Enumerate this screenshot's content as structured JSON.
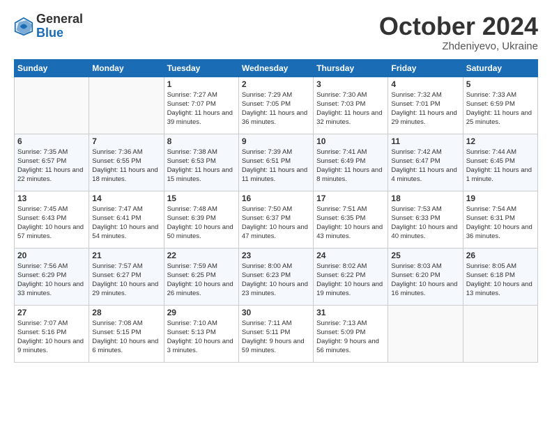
{
  "logo": {
    "general": "General",
    "blue": "Blue"
  },
  "header": {
    "month": "October 2024",
    "location": "Zhdeniyevo, Ukraine"
  },
  "weekdays": [
    "Sunday",
    "Monday",
    "Tuesday",
    "Wednesday",
    "Thursday",
    "Friday",
    "Saturday"
  ],
  "weeks": [
    [
      {
        "day": "",
        "empty": true
      },
      {
        "day": "",
        "empty": true
      },
      {
        "day": "1",
        "info": "Sunrise: 7:27 AM\nSunset: 7:07 PM\nDaylight: 11 hours and 39 minutes."
      },
      {
        "day": "2",
        "info": "Sunrise: 7:29 AM\nSunset: 7:05 PM\nDaylight: 11 hours and 36 minutes."
      },
      {
        "day": "3",
        "info": "Sunrise: 7:30 AM\nSunset: 7:03 PM\nDaylight: 11 hours and 32 minutes."
      },
      {
        "day": "4",
        "info": "Sunrise: 7:32 AM\nSunset: 7:01 PM\nDaylight: 11 hours and 29 minutes."
      },
      {
        "day": "5",
        "info": "Sunrise: 7:33 AM\nSunset: 6:59 PM\nDaylight: 11 hours and 25 minutes."
      }
    ],
    [
      {
        "day": "6",
        "info": "Sunrise: 7:35 AM\nSunset: 6:57 PM\nDaylight: 11 hours and 22 minutes."
      },
      {
        "day": "7",
        "info": "Sunrise: 7:36 AM\nSunset: 6:55 PM\nDaylight: 11 hours and 18 minutes."
      },
      {
        "day": "8",
        "info": "Sunrise: 7:38 AM\nSunset: 6:53 PM\nDaylight: 11 hours and 15 minutes."
      },
      {
        "day": "9",
        "info": "Sunrise: 7:39 AM\nSunset: 6:51 PM\nDaylight: 11 hours and 11 minutes."
      },
      {
        "day": "10",
        "info": "Sunrise: 7:41 AM\nSunset: 6:49 PM\nDaylight: 11 hours and 8 minutes."
      },
      {
        "day": "11",
        "info": "Sunrise: 7:42 AM\nSunset: 6:47 PM\nDaylight: 11 hours and 4 minutes."
      },
      {
        "day": "12",
        "info": "Sunrise: 7:44 AM\nSunset: 6:45 PM\nDaylight: 11 hours and 1 minute."
      }
    ],
    [
      {
        "day": "13",
        "info": "Sunrise: 7:45 AM\nSunset: 6:43 PM\nDaylight: 10 hours and 57 minutes."
      },
      {
        "day": "14",
        "info": "Sunrise: 7:47 AM\nSunset: 6:41 PM\nDaylight: 10 hours and 54 minutes."
      },
      {
        "day": "15",
        "info": "Sunrise: 7:48 AM\nSunset: 6:39 PM\nDaylight: 10 hours and 50 minutes."
      },
      {
        "day": "16",
        "info": "Sunrise: 7:50 AM\nSunset: 6:37 PM\nDaylight: 10 hours and 47 minutes."
      },
      {
        "day": "17",
        "info": "Sunrise: 7:51 AM\nSunset: 6:35 PM\nDaylight: 10 hours and 43 minutes."
      },
      {
        "day": "18",
        "info": "Sunrise: 7:53 AM\nSunset: 6:33 PM\nDaylight: 10 hours and 40 minutes."
      },
      {
        "day": "19",
        "info": "Sunrise: 7:54 AM\nSunset: 6:31 PM\nDaylight: 10 hours and 36 minutes."
      }
    ],
    [
      {
        "day": "20",
        "info": "Sunrise: 7:56 AM\nSunset: 6:29 PM\nDaylight: 10 hours and 33 minutes."
      },
      {
        "day": "21",
        "info": "Sunrise: 7:57 AM\nSunset: 6:27 PM\nDaylight: 10 hours and 29 minutes."
      },
      {
        "day": "22",
        "info": "Sunrise: 7:59 AM\nSunset: 6:25 PM\nDaylight: 10 hours and 26 minutes."
      },
      {
        "day": "23",
        "info": "Sunrise: 8:00 AM\nSunset: 6:23 PM\nDaylight: 10 hours and 23 minutes."
      },
      {
        "day": "24",
        "info": "Sunrise: 8:02 AM\nSunset: 6:22 PM\nDaylight: 10 hours and 19 minutes."
      },
      {
        "day": "25",
        "info": "Sunrise: 8:03 AM\nSunset: 6:20 PM\nDaylight: 10 hours and 16 minutes."
      },
      {
        "day": "26",
        "info": "Sunrise: 8:05 AM\nSunset: 6:18 PM\nDaylight: 10 hours and 13 minutes."
      }
    ],
    [
      {
        "day": "27",
        "info": "Sunrise: 7:07 AM\nSunset: 5:16 PM\nDaylight: 10 hours and 9 minutes."
      },
      {
        "day": "28",
        "info": "Sunrise: 7:08 AM\nSunset: 5:15 PM\nDaylight: 10 hours and 6 minutes."
      },
      {
        "day": "29",
        "info": "Sunrise: 7:10 AM\nSunset: 5:13 PM\nDaylight: 10 hours and 3 minutes."
      },
      {
        "day": "30",
        "info": "Sunrise: 7:11 AM\nSunset: 5:11 PM\nDaylight: 9 hours and 59 minutes."
      },
      {
        "day": "31",
        "info": "Sunrise: 7:13 AM\nSunset: 5:09 PM\nDaylight: 9 hours and 56 minutes."
      },
      {
        "day": "",
        "empty": true
      },
      {
        "day": "",
        "empty": true
      }
    ]
  ]
}
